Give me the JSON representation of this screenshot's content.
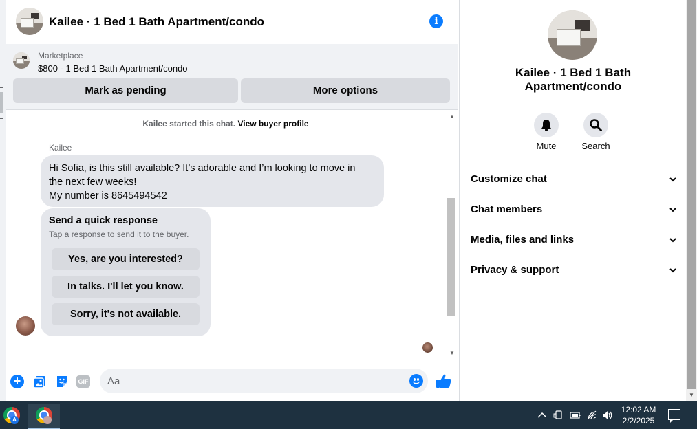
{
  "conversation": {
    "title": "Kailee · 1 Bed 1 Bath Apartment/condo"
  },
  "marketplace": {
    "label": "Marketplace",
    "listing": "$800 - 1 Bed 1 Bath Apartment/condo",
    "buttons": [
      "Mark as pending",
      "More options"
    ]
  },
  "messages": {
    "system_text": "Kailee started this chat.",
    "system_link": "View buyer profile",
    "sender": "Kailee",
    "lines": [
      "Hi Sofia, is this still available? It’s adorable and I’m looking to move in",
      "the next few weeks!",
      "My number is 8645494542"
    ],
    "quick_response": {
      "title": "Send a quick response",
      "subtitle": "Tap a response to send it to the buyer.",
      "options": [
        "Yes, are you interested?",
        "In talks. I'll let you know.",
        "Sorry, it's not available."
      ]
    }
  },
  "composer": {
    "placeholder": "Aa",
    "gif_label": "GIF",
    "icons": [
      "plus-icon",
      "photo-icon",
      "sticker-icon",
      "gif-icon",
      "emoji-icon",
      "like-icon"
    ]
  },
  "info_panel": {
    "title": "Kailee · 1 Bed 1 Bath Apartment/condo",
    "actions": [
      {
        "label": "Mute",
        "icon": "bell-icon"
      },
      {
        "label": "Search",
        "icon": "search-icon"
      }
    ],
    "sections": [
      "Customize chat",
      "Chat members",
      "Media, files and links",
      "Privacy & support"
    ]
  },
  "taskbar": {
    "badge_letter": "A",
    "time": "12:02 AM",
    "date": "2/2/2025"
  },
  "colors": {
    "accent": "#0a7cff",
    "bubble": "#e4e6eb",
    "panel_bg": "#f0f2f5",
    "taskbar": "#1e3140"
  }
}
